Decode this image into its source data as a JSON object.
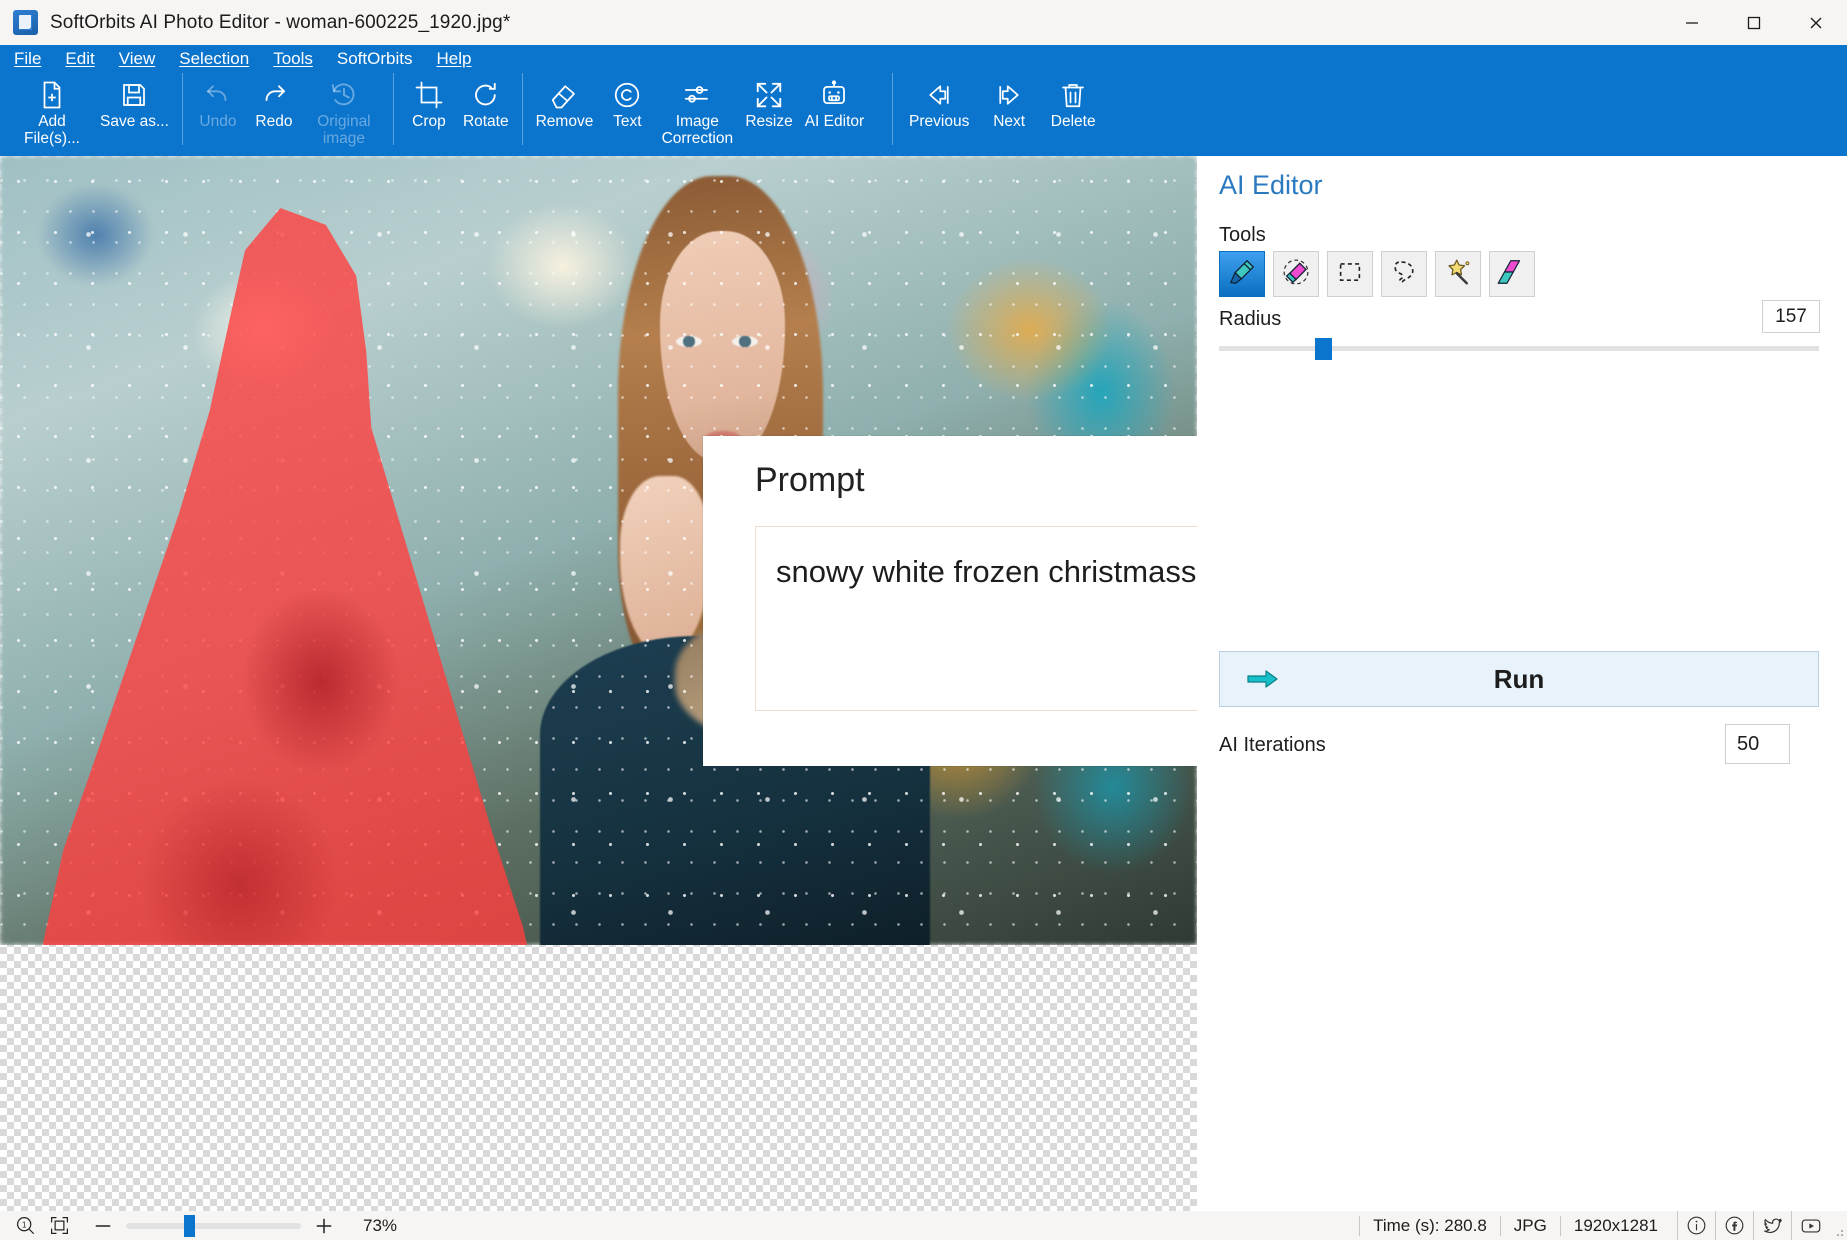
{
  "window": {
    "title": "SoftOrbits AI Photo Editor - woman-600225_1920.jpg*",
    "icon": "app-icon",
    "controls": {
      "minimize": "minimize",
      "maximize": "maximize",
      "close": "close"
    }
  },
  "menubar": {
    "items": [
      {
        "label": "File",
        "accel": "F"
      },
      {
        "label": "Edit",
        "accel": "E"
      },
      {
        "label": "View",
        "accel": "V"
      },
      {
        "label": "Selection",
        "accel": "S"
      },
      {
        "label": "Tools",
        "accel": "T"
      },
      {
        "label": "SoftOrbits",
        "accel": ""
      },
      {
        "label": "Help",
        "accel": "H"
      }
    ]
  },
  "toolbar": {
    "groups": [
      {
        "buttons": [
          {
            "label": "Add File(s)...",
            "icon": "add-file-icon",
            "disabled": false,
            "accel": "F"
          },
          {
            "label": "Save as...",
            "icon": "save-icon",
            "disabled": false,
            "accel": "S"
          }
        ]
      },
      {
        "buttons": [
          {
            "label": "Undo",
            "icon": "undo-icon",
            "disabled": true,
            "accel": "U"
          },
          {
            "label": "Redo",
            "icon": "redo-icon",
            "disabled": false,
            "accel": "R"
          },
          {
            "label": "Original image",
            "icon": "history-icon",
            "disabled": true,
            "accel": ""
          }
        ]
      },
      {
        "buttons": [
          {
            "label": "Crop",
            "icon": "crop-icon",
            "disabled": false,
            "accel": ""
          },
          {
            "label": "Rotate",
            "icon": "rotate-icon",
            "disabled": false,
            "accel": ""
          }
        ]
      },
      {
        "buttons": [
          {
            "label": "Remove",
            "icon": "eraser-icon",
            "disabled": false,
            "accel": "v"
          },
          {
            "label": "Text",
            "icon": "copyright-icon",
            "disabled": false,
            "accel": ""
          },
          {
            "label": "Image Correction",
            "icon": "sliders-icon",
            "disabled": false,
            "accel": ""
          },
          {
            "label": "Resize",
            "icon": "resize-icon",
            "disabled": false,
            "accel": ""
          },
          {
            "label": "AI Editor",
            "icon": "robot-icon",
            "disabled": false,
            "accel": ""
          }
        ]
      },
      {
        "buttons": [
          {
            "label": "Previous",
            "icon": "arrow-left-icon",
            "disabled": false,
            "accel": ""
          },
          {
            "label": "Next",
            "icon": "arrow-right-icon",
            "disabled": false,
            "accel": ""
          },
          {
            "label": "Delete",
            "icon": "trash-icon",
            "disabled": false,
            "accel": ""
          }
        ]
      }
    ]
  },
  "canvas": {
    "selection_mask_color": "#FF3E3E",
    "image_name": "woman-600225_1920.jpg"
  },
  "prompt_panel": {
    "title": "Prompt",
    "value": "snowy white frozen christmass tree",
    "placeholder": "",
    "scroll_up": "scroll-up",
    "scroll_down": "scroll-down"
  },
  "ai_panel": {
    "title": "AI Editor",
    "tools_label": "Tools",
    "accent_color": "#0B74CD",
    "tools": [
      {
        "name": "marker-tool",
        "icon": "marker-icon",
        "active": true
      },
      {
        "name": "eraser-tool",
        "icon": "eraser-icon",
        "active": false
      },
      {
        "name": "rectangle-select-tool",
        "icon": "rectangle-select-icon",
        "active": false
      },
      {
        "name": "lasso-tool",
        "icon": "lasso-icon",
        "active": false
      },
      {
        "name": "magic-wand-tool",
        "icon": "magic-wand-icon",
        "active": false
      },
      {
        "name": "fill-tool",
        "icon": "fill-gradient-icon",
        "active": false
      }
    ],
    "radius": {
      "label": "Radius",
      "value": "157",
      "min": 1,
      "max": 1000,
      "percent": 16
    },
    "run": {
      "label": "Run",
      "icon": "arrow-run-icon"
    },
    "iterations": {
      "label": "AI Iterations",
      "value": "50"
    }
  },
  "statusbar": {
    "zoom_one_to_one": "zoom-actual-size-icon",
    "fit_to_screen": "fit-to-screen-icon",
    "zoom_out": "minus-icon",
    "zoom_in": "plus-icon",
    "zoom_percent": "73%",
    "zoom_slider_percent": 33,
    "time": "Time (s): 280.8",
    "format": "JPG",
    "dimensions": "1920x1281",
    "info_icon": "info-icon",
    "facebook_icon": "facebook-icon",
    "twitter_icon": "twitter-icon",
    "youtube_icon": "youtube-icon"
  }
}
